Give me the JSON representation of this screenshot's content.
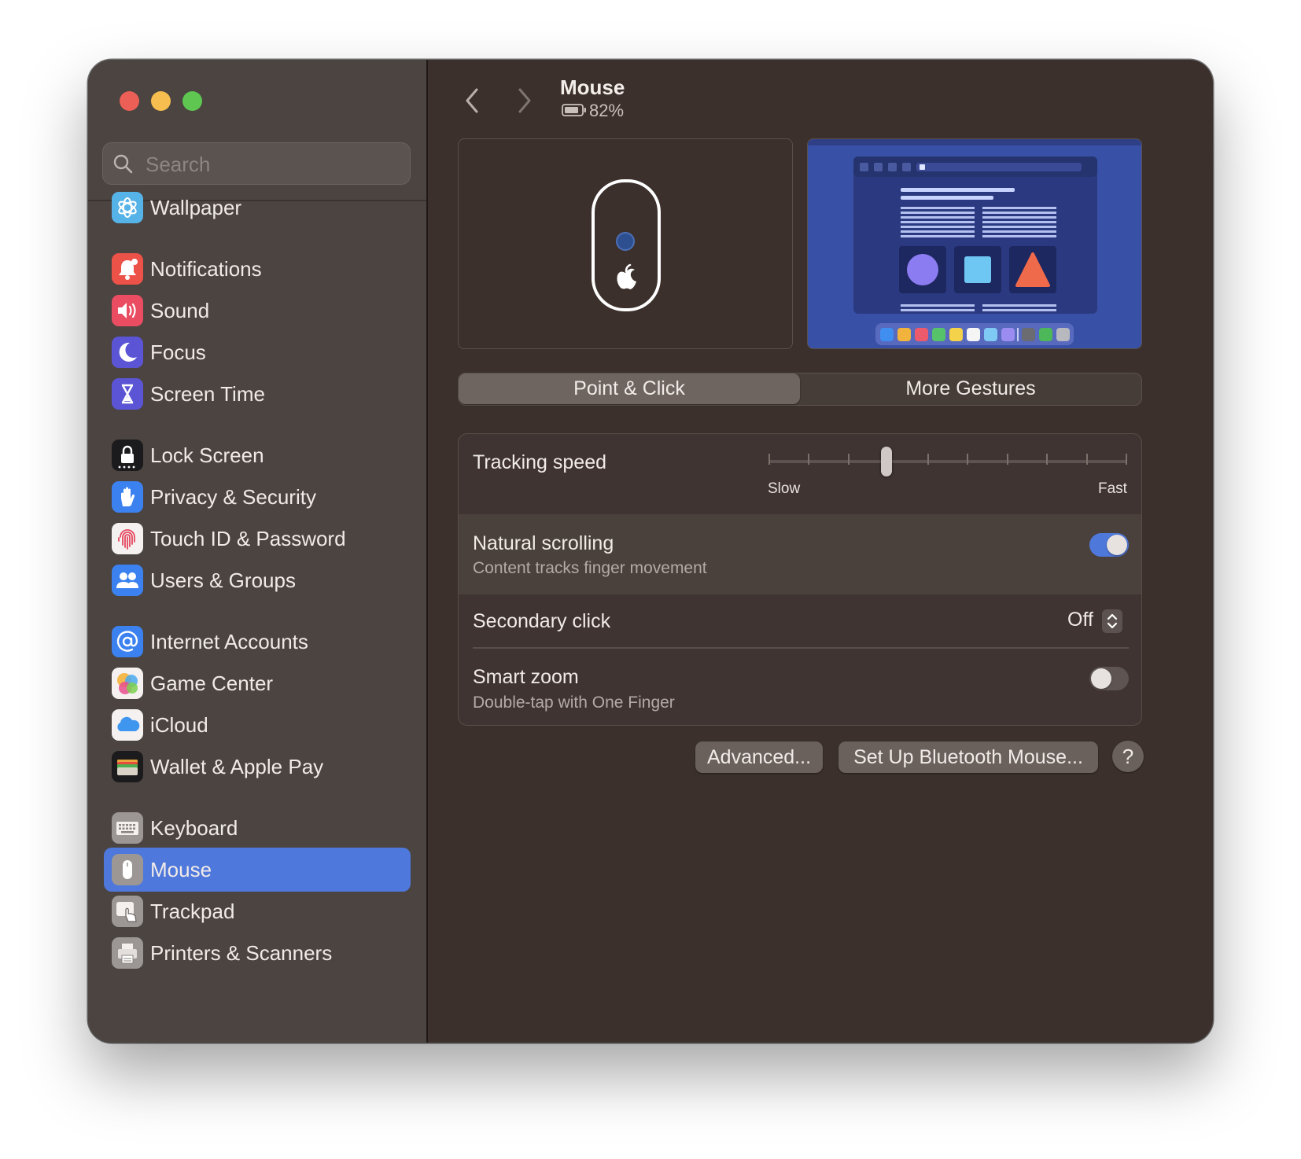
{
  "window": {
    "title": "Mouse",
    "battery": "82%"
  },
  "search": {
    "placeholder": "Search"
  },
  "sidebar": {
    "items": [
      {
        "label": "Wallpaper",
        "icon": "wallpaper-icon"
      },
      {
        "label": "Notifications",
        "icon": "notifications-icon"
      },
      {
        "label": "Sound",
        "icon": "sound-icon"
      },
      {
        "label": "Focus",
        "icon": "focus-icon"
      },
      {
        "label": "Screen Time",
        "icon": "screen-time-icon"
      },
      {
        "label": "Lock Screen",
        "icon": "lock-screen-icon"
      },
      {
        "label": "Privacy & Security",
        "icon": "privacy-hand-icon"
      },
      {
        "label": "Touch ID & Password",
        "icon": "fingerprint-icon"
      },
      {
        "label": "Users & Groups",
        "icon": "users-icon"
      },
      {
        "label": "Internet Accounts",
        "icon": "at-sign-icon"
      },
      {
        "label": "Game Center",
        "icon": "game-center-icon"
      },
      {
        "label": "iCloud",
        "icon": "icloud-icon"
      },
      {
        "label": "Wallet & Apple Pay",
        "icon": "wallet-icon"
      },
      {
        "label": "Keyboard",
        "icon": "keyboard-icon"
      },
      {
        "label": "Mouse",
        "icon": "mouse-icon",
        "selected": true
      },
      {
        "label": "Trackpad",
        "icon": "trackpad-icon"
      },
      {
        "label": "Printers & Scanners",
        "icon": "printer-icon"
      }
    ]
  },
  "tabs": [
    {
      "label": "Point & Click",
      "selected": true
    },
    {
      "label": "More Gestures",
      "selected": false
    }
  ],
  "settings": {
    "tracking_speed": {
      "label": "Tracking speed",
      "min_label": "Slow",
      "max_label": "Fast",
      "level": 0.33,
      "ticks": 10
    },
    "natural_scrolling": {
      "label": "Natural scrolling",
      "description": "Content tracks finger movement",
      "enabled": true
    },
    "secondary_click": {
      "label": "Secondary click",
      "value": "Off"
    },
    "smart_zoom": {
      "label": "Smart zoom",
      "description": "Double-tap with One Finger",
      "enabled": false
    }
  },
  "buttons": {
    "advanced": "Advanced...",
    "bluetooth": "Set Up Bluetooth Mouse...",
    "help": "?"
  },
  "colors": {
    "accent": "#4e78db",
    "sidebar": "#4b4441",
    "content": "#3b302c"
  }
}
